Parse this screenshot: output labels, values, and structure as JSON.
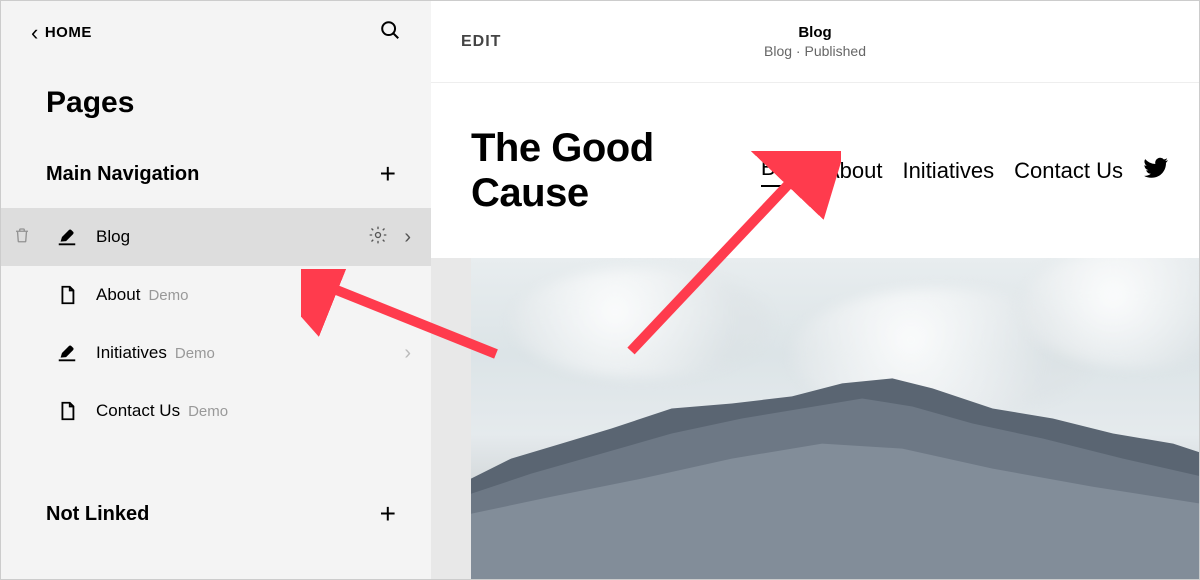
{
  "sidebar": {
    "home_label": "HOME",
    "section_title": "Pages",
    "main_nav_label": "Main Navigation",
    "not_linked_label": "Not Linked",
    "pages": [
      {
        "label": "Blog",
        "demo": "",
        "icon": "pen",
        "selected": true,
        "has_chevron": true
      },
      {
        "label": "About",
        "demo": "Demo",
        "icon": "file",
        "selected": false,
        "has_chevron": false
      },
      {
        "label": "Initiatives",
        "demo": "Demo",
        "icon": "pen",
        "selected": false,
        "has_chevron": true
      },
      {
        "label": "Contact Us",
        "demo": "Demo",
        "icon": "file",
        "selected": false,
        "has_chevron": false
      }
    ]
  },
  "preview": {
    "edit_label": "EDIT",
    "topbar_title": "Blog",
    "topbar_sub": "Blog · Published",
    "site_title": "The Good Cause",
    "nav": [
      {
        "label": "Blog",
        "active": true
      },
      {
        "label": "About",
        "active": false
      },
      {
        "label": "Initiatives",
        "active": false
      },
      {
        "label": "Contact Us",
        "active": false
      }
    ]
  }
}
